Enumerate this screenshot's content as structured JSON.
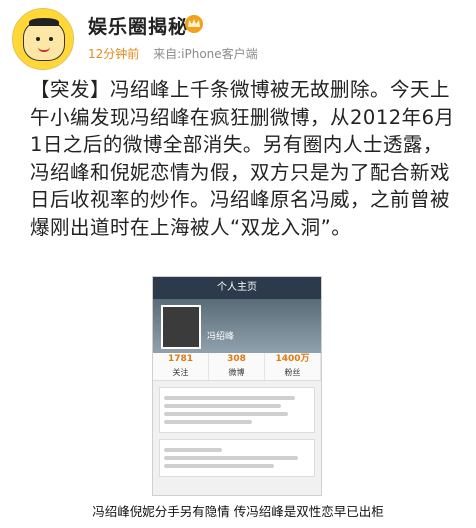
{
  "header": {
    "username": "娱乐圈揭秘",
    "time": "12分钟前",
    "source": "来自:iPhone客户端",
    "badge_icon": "crown-icon"
  },
  "post": {
    "text": "【突发】冯绍峰上千条微博被无故删除。今天上午小编发现冯绍峰在疯狂删微博，从2012年6月1日之后的微博全部消失。另有圈内人士透露，冯绍峰和倪妮恋情为假，双方只是为了配合新戏日后收视率的炒作。冯绍峰原名冯威，之前曾被爆刚出道时在上海被人“双龙入洞”。"
  },
  "screenshot": {
    "title": "个人主页",
    "name": "冯绍峰",
    "stats": [
      {
        "value": "1781",
        "label": "关注"
      },
      {
        "value": "308",
        "label": "微博"
      },
      {
        "value": "1400万",
        "label": "粉丝"
      }
    ]
  },
  "caption": "冯绍峰倪妮分手另有隐情 传冯绍峰是双性恋早已出柜",
  "colors": {
    "accent_time": "#e58a17",
    "meta_gray": "#8a8a8a"
  }
}
